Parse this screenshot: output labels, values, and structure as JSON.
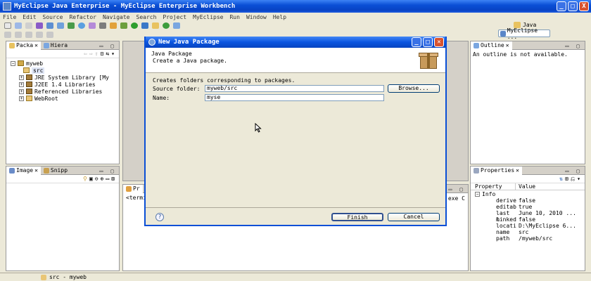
{
  "window": {
    "title": "MyEclipse Java Enterprise - MyEclipse Enterprise Workbench",
    "buttons": [
      "_",
      "□",
      "X"
    ]
  },
  "menu": [
    "File",
    "Edit",
    "Source",
    "Refactor",
    "Navigate",
    "Search",
    "Project",
    "MyEclipse",
    "Run",
    "Window",
    "Help"
  ],
  "perspectives": {
    "java": "Java",
    "myeclipse": "MyEclipse ..."
  },
  "left_view": {
    "tabs": [
      "Packa",
      "Hiera"
    ],
    "tree": {
      "project": "myweb",
      "src": "src",
      "items": [
        "JRE System Library [My",
        "J2EE 1.4 Libraries",
        "Referenced Libraries",
        "WebRoot"
      ]
    }
  },
  "bottom_left_view": {
    "tabs": [
      "Image",
      "Snipp"
    ]
  },
  "console_view": {
    "tab": "Pr",
    "terminated": "<termi",
    "tail": "exe C"
  },
  "outline_view": {
    "tab": "Outline",
    "message": "An outline is not available."
  },
  "properties_view": {
    "tab": "Properties",
    "headers": [
      "Property",
      "Value"
    ],
    "group": "Info",
    "rows": [
      [
        "derive",
        "false"
      ],
      [
        "editab",
        "true"
      ],
      [
        "last m",
        "June 10, 2010 ..."
      ],
      [
        "linked",
        "false"
      ],
      [
        "locati",
        "D:\\MyEclipse 6..."
      ],
      [
        "name",
        "src"
      ],
      [
        "path",
        "/myweb/src"
      ]
    ]
  },
  "dialog": {
    "title": "New Java Package",
    "header_title": "Java Package",
    "header_desc": "Create a Java package.",
    "desc": "Creates folders corresponding to packages.",
    "source_label": "Source folder:",
    "source_value": "myweb/src",
    "browse": "Browse...",
    "name_label": "Name:",
    "name_value": "myse",
    "help": "?",
    "finish": "Finish",
    "cancel": "Cancel"
  },
  "status": {
    "text": "src - myweb"
  }
}
